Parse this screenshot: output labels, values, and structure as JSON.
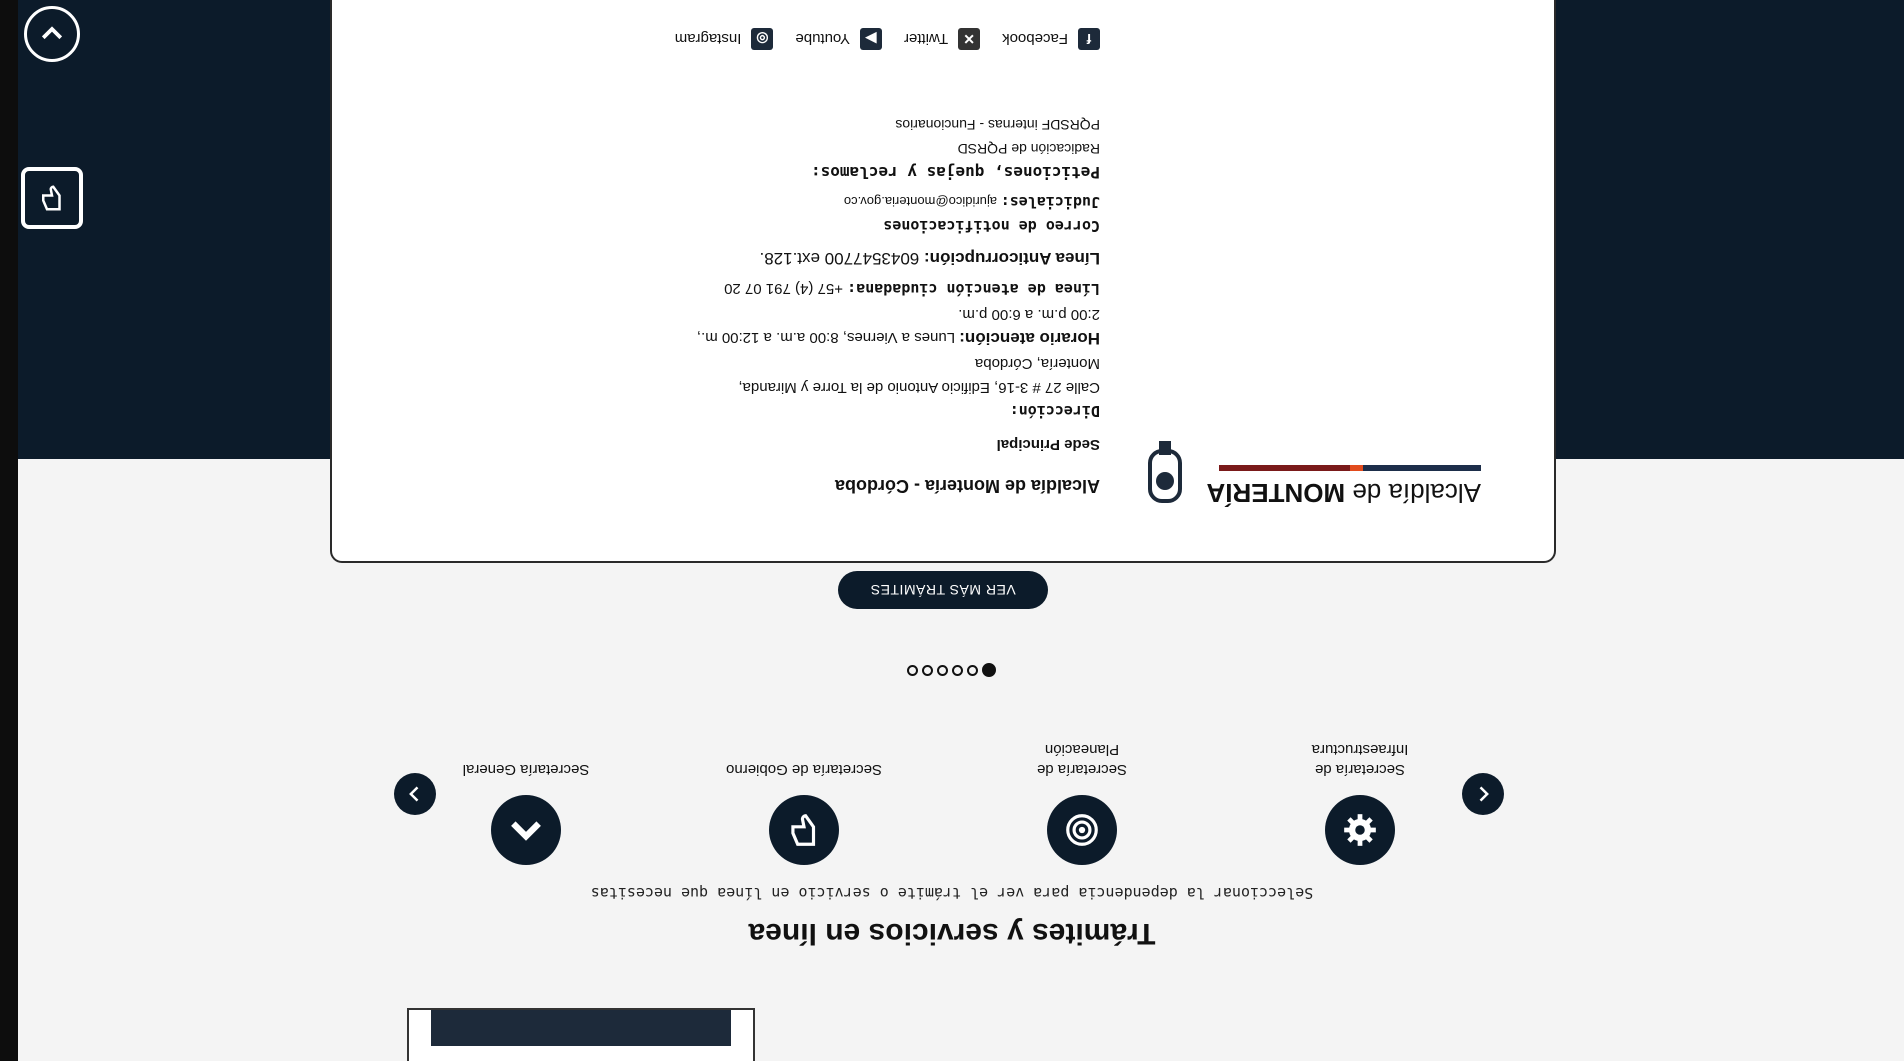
{
  "section": {
    "title": "Trámites y servicios en línea",
    "subtitle": "Seleccionar la dependencia para ver el trámite o servicio en línea que necesitas"
  },
  "carousel": {
    "items": [
      {
        "label": "Secretaría de Infraestructura",
        "icon": "gear-icon"
      },
      {
        "label": "Secretaría de Planeación",
        "icon": "target-icon"
      },
      {
        "label": "Secretaría de Gobierno",
        "icon": "thumbs-down-icon"
      },
      {
        "label": "Secretaría General",
        "icon": "chevron-up-icon"
      }
    ],
    "dots_total": 6,
    "active_dot": 1
  },
  "more_button": "VER MÁS TRÁMITES",
  "footer": {
    "title": "Alcaldía de Montería - Córdoba",
    "sede": "Sede Principal",
    "direccion_label": "Dirección:",
    "direccion_1": "Calle 27 # 3-16, Edificio Antonio de la Torre y Miranda,",
    "direccion_2": "Montería, Córdoba",
    "horario_label": "Horario atención:",
    "horario_1": " Lunes a Viernes, 8:00 a.m. a 12:00 m.,",
    "horario_2": "2:00 p.m. a 6:00 p.m.",
    "linea_label": "Línea de atención ciudadana:",
    "linea_value": " +57 (4) 791 07 20",
    "anticorr_label": "Línea Anticorrupción:",
    "anticorr_value": " 6043547700 ext.128.",
    "correo_label": "Correo de notificaciones",
    "judiciales_label": "Judiciales:",
    "judiciales_value": " ajuridico@monteria.gov.co",
    "peticiones_label": "Peticiones, quejas y reclamos:",
    "radicacion": "Radicación de PQRSD",
    "pqrsdf": "PQRSDF internas - Funcionarios",
    "logo_text_1": "Alcaldía de ",
    "logo_text_2": "MONTERÍA",
    "social": [
      {
        "label": "Facebook",
        "icon": "facebook-icon",
        "glyph": "f"
      },
      {
        "label": "Twitter",
        "icon": "x-icon",
        "glyph": "✕"
      },
      {
        "label": "Youtube",
        "icon": "youtube-icon",
        "glyph": "▶"
      },
      {
        "label": "Instagram",
        "icon": "instagram-icon",
        "glyph": "◎"
      }
    ]
  }
}
